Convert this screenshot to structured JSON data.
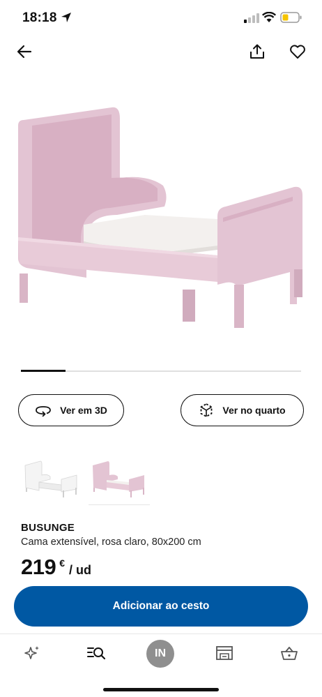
{
  "status_bar": {
    "time": "18:18",
    "icons": [
      "location-arrow-icon",
      "signal-icon",
      "wifi-icon",
      "battery-icon"
    ],
    "battery_color": "#f5c400"
  },
  "top_bar": {
    "icons": [
      "back-arrow-icon",
      "share-icon",
      "heart-icon"
    ]
  },
  "product_image": {
    "description_icon": "pink-extendable-bed",
    "color": "#e3c4d3"
  },
  "carousel": {
    "progress": 0.16
  },
  "actions": {
    "view_3d_label": "Ver em 3D",
    "view_room_label": "Ver no quarto"
  },
  "variants": [
    {
      "color_name": "white",
      "color": "#f2f2f2"
    },
    {
      "color_name": "light pink",
      "color": "#e3c4d3",
      "selected": true
    }
  ],
  "product": {
    "name": "BUSUNGE",
    "description": "Cama extensível, rosa claro, 80x200 cm",
    "price": "219",
    "currency": "€",
    "unit": "/ ud"
  },
  "cta": {
    "label": "Adicionar ao cesto",
    "color": "#0058a3"
  },
  "bottom_nav": {
    "profile_initials": "IN",
    "icons": [
      "sparkle-icon",
      "search-list-icon",
      "avatar",
      "store-icon",
      "basket-icon"
    ]
  }
}
